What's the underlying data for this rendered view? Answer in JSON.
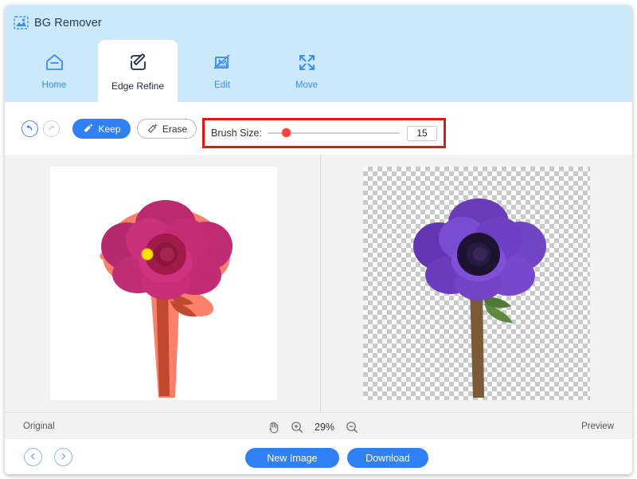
{
  "window": {
    "title": "BG Remover",
    "logo_icon": "image-dashed-icon"
  },
  "tabs": [
    {
      "id": "home",
      "label": "Home",
      "icon": "home-icon",
      "active": false
    },
    {
      "id": "edge_refine",
      "label": "Edge Refine",
      "icon": "edge-refine-pen-icon",
      "active": true
    },
    {
      "id": "edit",
      "label": "Edit",
      "icon": "image-edit-icon",
      "active": false
    },
    {
      "id": "move",
      "label": "Move",
      "icon": "move-arrows-icon",
      "active": false
    }
  ],
  "toolbar": {
    "undo_icon": "undo-arrow-icon",
    "redo_icon": "redo-arrow-icon",
    "keep_label": "Keep",
    "keep_icon": "brush-keep-icon",
    "erase_label": "Erase",
    "erase_icon": "brush-erase-icon",
    "brush": {
      "label": "Brush Size:",
      "value": "15",
      "min": "1",
      "max": "100",
      "percent": 14
    },
    "highlight_color": "#ee1111"
  },
  "canvas": {
    "original": {
      "caption": "Original",
      "mask_color": "#fa7a63",
      "flower_color": "#c32b74",
      "cursor_dot_color": "#ffe000"
    },
    "preview": {
      "caption": "Preview",
      "flower_color": "#7a45c8",
      "checker_color": "#c9c9c9"
    }
  },
  "status": {
    "left_label": "Original",
    "right_label": "Preview",
    "zoom_level": "29%",
    "hand_icon": "hand-tool-icon",
    "zoom_in_icon": "zoom-in-icon",
    "zoom_out_icon": "zoom-out-icon"
  },
  "footer": {
    "prev_icon": "chevron-left-icon",
    "next_icon": "chevron-right-icon",
    "new_image_label": "New Image",
    "download_label": "Download"
  },
  "colors": {
    "header_bg": "#cbe9fb",
    "accent_blue": "#2f80f5",
    "tab_text": "#3b8cf5",
    "active_tab_text": "#1b2a47"
  }
}
